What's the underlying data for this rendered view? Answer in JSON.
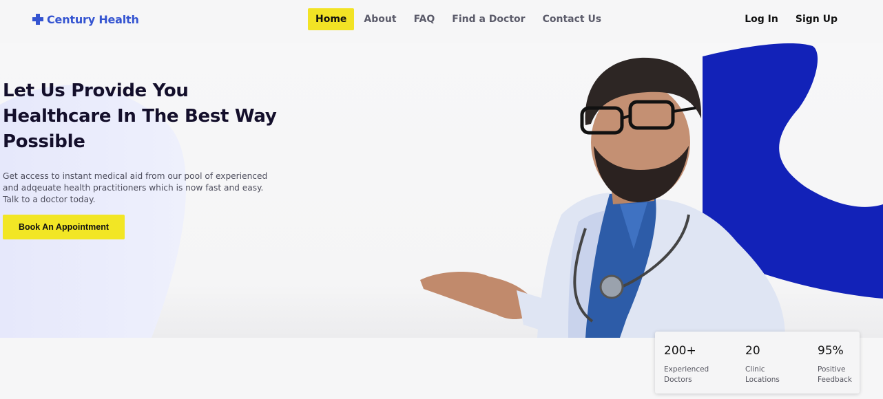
{
  "brand": {
    "name": "Century Health",
    "icon": "medical-cross-icon",
    "color": "#3454d1"
  },
  "nav": {
    "items": [
      {
        "label": "Home",
        "active": true
      },
      {
        "label": "About",
        "active": false
      },
      {
        "label": "FAQ",
        "active": false
      },
      {
        "label": "Find a Doctor",
        "active": false
      },
      {
        "label": "Contact Us",
        "active": false
      }
    ]
  },
  "auth": {
    "login_label": "Log In",
    "signup_label": "Sign Up"
  },
  "hero": {
    "title_line1": "Let Us Provide You",
    "title_line2": "Healthcare In The Best Way",
    "title_line3": "Possible",
    "description": "Get access to instant medical aid from our pool of experienced and adqeuate health practitioners which is now fast and easy. Talk to a doctor today.",
    "cta_label": "Book An Appointment"
  },
  "stats": [
    {
      "value": "200+",
      "label": "Experienced Doctors"
    },
    {
      "value": "20",
      "label": "Clinic Locations"
    },
    {
      "value": "95%",
      "label": "Positive Feedback"
    }
  ],
  "colors": {
    "accent_yellow": "#f2e325",
    "accent_blue": "#1222b8",
    "text_dark": "#14102b"
  }
}
